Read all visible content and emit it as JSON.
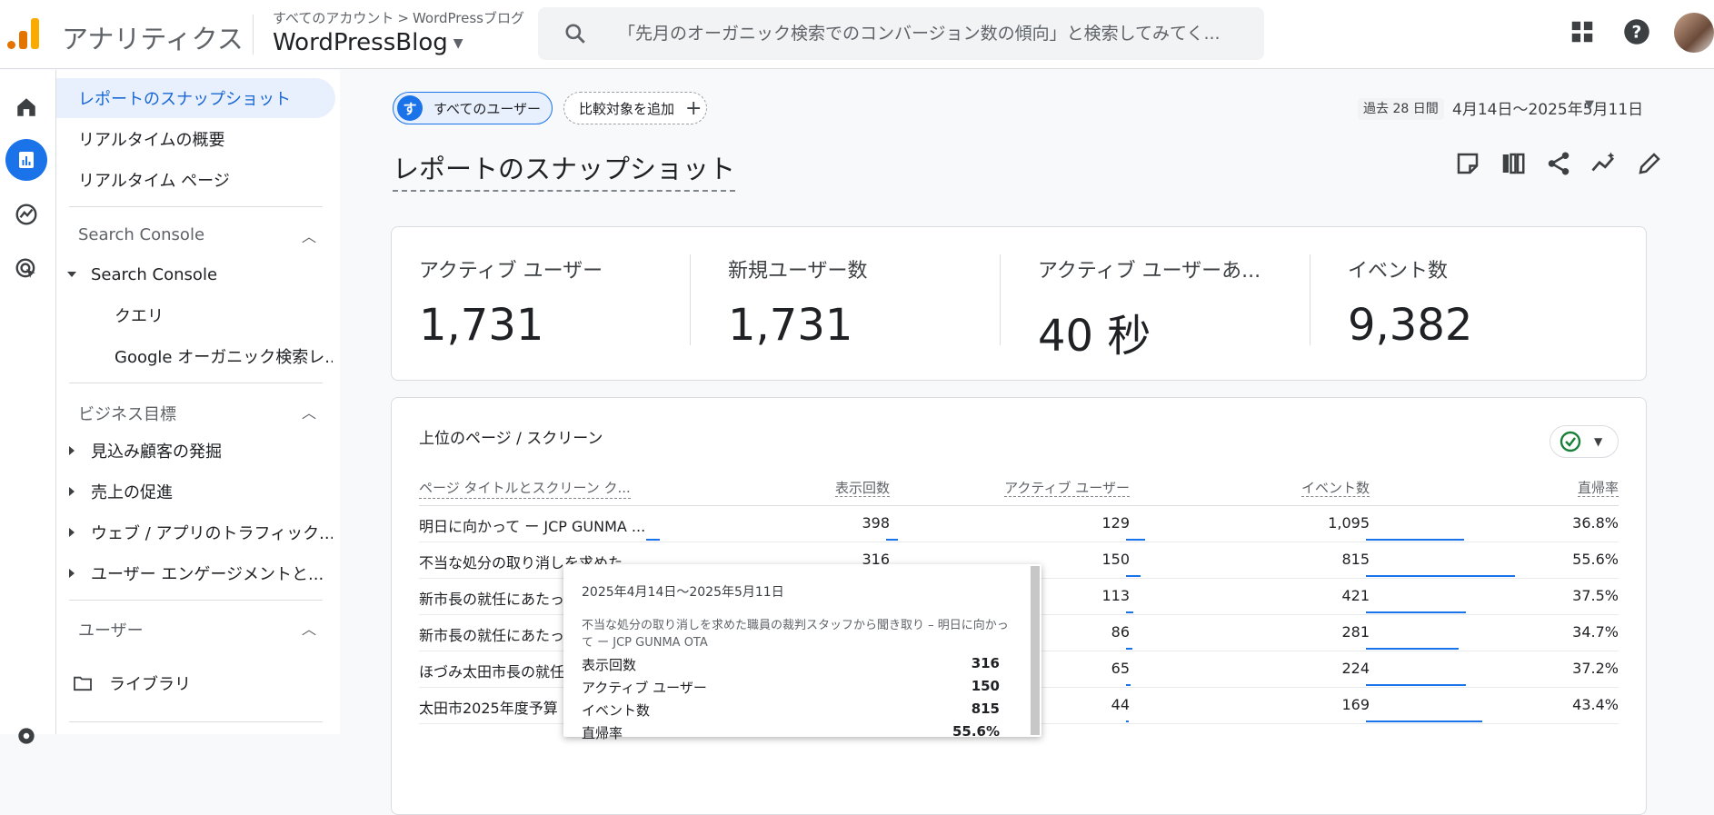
{
  "header": {
    "app_title": "アナリティクス",
    "breadcrumb": [
      "すべてのアカウント",
      "WordPressブログ"
    ],
    "property": "WordPressBlog",
    "search_placeholder": "「先月のオーガニック検索でのコンバージョン数の傾向」と検索してみてく..."
  },
  "sidenav": {
    "items_top": [
      "レポートのスナップショット",
      "リアルタイムの概要",
      "リアルタイム ページ"
    ],
    "sec_search_console": "Search Console",
    "sc_group": "Search Console",
    "sc_children": [
      "クエリ",
      "Google オーガニック検索レ..."
    ],
    "sec_business": "ビジネス目標",
    "business_items": [
      "見込み顧客の発掘",
      "売上の促進",
      "ウェブ / アプリのトラフィック...",
      "ユーザー エンゲージメントと..."
    ],
    "sec_user": "ユーザー",
    "library": "ライブラリ"
  },
  "filters": {
    "user_chip_initial": "す",
    "user_chip": "すべてのユーザー",
    "add_compare": "比較対象を追加",
    "period_label": "過去 28 日間",
    "period_value": "4月14日〜2025年5月11日"
  },
  "page_title": "レポートのスナップショット",
  "kpis": [
    {
      "label": "アクティブ ユーザー",
      "value": "1,731"
    },
    {
      "label": "新規ユーザー数",
      "value": "1,731"
    },
    {
      "label": "アクティブ ユーザーあ...",
      "value": "40 秒"
    },
    {
      "label": "イベント数",
      "value": "9,382"
    }
  ],
  "table": {
    "title": "上位のページ / スクリーン",
    "headers": [
      "ページ タイトルとスクリーン ク...",
      "表示回数",
      "アクティブ ユーザー",
      "イベント数",
      "直帰率"
    ],
    "rows": [
      {
        "title": "明日に向かって ー JCP GUNMA ...",
        "views": "398",
        "users": "129",
        "events": "1,095",
        "bounce": "36.8%",
        "bar_views": 0.09,
        "bar_users": 0.08,
        "bar_events": 0.13,
        "bar_bounce": 0.66
      },
      {
        "title": "不当な処分の取り消しを求めた...",
        "views": "316",
        "users": "150",
        "events": "815",
        "bounce": "55.6%",
        "bar_views": 0.07,
        "bar_users": 0.09,
        "bar_events": 0.1,
        "bar_bounce": 1.0
      },
      {
        "title": "新市長の就任にあたって...",
        "views": "",
        "users": "113",
        "events": "421",
        "bounce": "37.5%",
        "bar_views": 0.05,
        "bar_users": 0.07,
        "bar_events": 0.05,
        "bar_bounce": 0.67
      },
      {
        "title": "新市長の就任にあたって...",
        "views": "",
        "users": "86",
        "events": "281",
        "bounce": "34.7%",
        "bar_views": 0.04,
        "bar_users": 0.05,
        "bar_events": 0.04,
        "bar_bounce": 0.62
      },
      {
        "title": "ほづみ太田市長の就任...",
        "views": "",
        "users": "65",
        "events": "224",
        "bounce": "37.2%",
        "bar_views": 0.03,
        "bar_users": 0.04,
        "bar_events": 0.03,
        "bar_bounce": 0.67
      },
      {
        "title": "太田市2025年度予算",
        "views": "",
        "users": "44",
        "events": "169",
        "bounce": "43.4%",
        "bar_views": 0.02,
        "bar_users": 0.03,
        "bar_events": 0.02,
        "bar_bounce": 0.78
      }
    ]
  },
  "tooltip": {
    "date": "2025年4月14日〜2025年5月11日",
    "title": "不当な処分の取り消しを求めた職員の裁判スタッフから聞き取り – 明日に向かって ー JCP GUNMA OTA",
    "rows": [
      {
        "label": "表示回数",
        "value": "316"
      },
      {
        "label": "アクティブ ユーザー",
        "value": "150"
      },
      {
        "label": "イベント数",
        "value": "815"
      },
      {
        "label": "直帰率",
        "value": "55.6%"
      }
    ]
  },
  "colors": {
    "accent": "#1a73e8",
    "logo_orange": "#f9ab00",
    "logo_dark": "#e37400"
  }
}
